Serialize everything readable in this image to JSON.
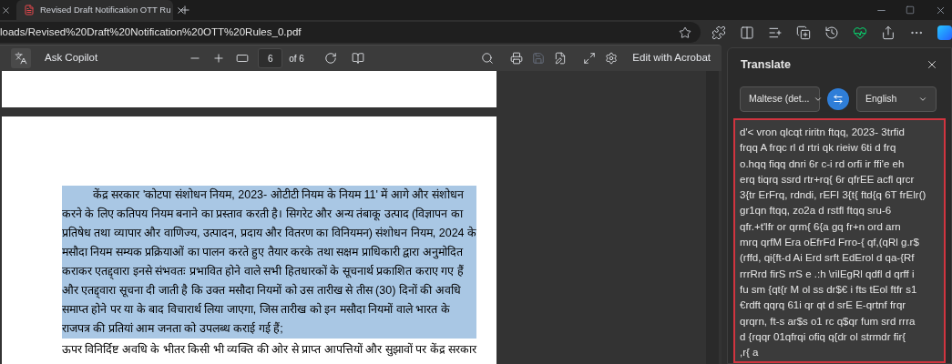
{
  "tabs": [
    {
      "title": "Revised Draft Notification OTT Ru",
      "selected": true
    }
  ],
  "address_bar": {
    "url": "loads/Revised%20Draft%20Notification%20OTT%20Rules_0.pdf"
  },
  "pdf_toolbar": {
    "ask_copilot": "Ask Copilot",
    "page_number": "6",
    "page_count": "of 6",
    "edit_button": "Edit with Acrobat",
    "save_disabled": true
  },
  "document": {
    "highlighted": true,
    "paragraph_lines": [
      "केंद्र सरकार 'कोटपा संशोधन नियम, 2023- ओटीटी नियम के नियम 11' में आगे और संशोधन",
      "करने के लिए कतिपय नियम बनाने का प्रस्ताव करती है। सिगरेट और अन्य तंबाकू उत्पाद (विज्ञापन का",
      "प्रतिषेध तथा व्यापार और वाणिज्य, उत्पादन, प्रदाय और वितरण का विनियमन) संशोधन नियम, 2024 के",
      "मसौदा नियम सम्यक प्रक्रियाओं का पालन करते हुए तैयार करके तथा सक्षम प्राधिकारी द्वारा अनुमोदित",
      "कराकर एतद्द्वारा इनसे संभवतः प्रभावित होने वाले सभी हितधारकों के सूचनार्थ प्रकाशित कराए गए हैं",
      "और एतद्द्वारा सूचना दी जाती है कि उक्त मसौदा नियमों को उस तारीख से तीस (30) दिनों की अवधि",
      "समाप्त होने पर या के बाद विचारार्थ लिया जाएगा, जिस तारीख को इन मसौदा नियमों वाले भारत के",
      "राजपत्र की प्रतियां आम जनता को उपलब्ध कराई गई हैं;"
    ],
    "next_line": "ऊपर विनिर्दिष्ट अवधि के भीतर किसी भी व्यक्ति की ओर से प्राप्त आपत्तियों और सुझावों पर केंद्र सरकार"
  },
  "translate_panel": {
    "title": "Translate",
    "source_language": "Maltese (det...",
    "target_language": "English",
    "output_lines": [
      "d'< vron qlcqt riritn ftqq, 2023- 3trfid",
      "frqq A frqc rl d rtri qk rieiw 6ti d frq",
      "o.hqq fiqq dnri 6r c-i rd orfi ir ffi'e eh",
      "erq tiqrq ssrd rtr+rq{ 6r qfrEE acfl qrcr",
      "3{tr ErFrq, rdndi, rEFI 3{t{ ftd{q 6T frElr()",
      "gr1qn ftqq, zo2a d rstfl ftqq sru-6",
      "qfr.+t'lfr or qrm{ 6{a gq fr+n ord arn",
      "mrq qrfM Era oEfrFd Frro-{ qf,(qRl g.r$",
      "(rffd, qi{ft-d Ai Erd srft EdErol d qa-{Rf",
      "rrrRrd firS rrS e .:h \\rilEgRl qdfl d qrff i",
      "fu sm {qt{r M ol ss dr$€ i fts tEol ftfr s1",
      "€rdft qqrq 61i qr qt d srE E-qrtnf frqr",
      "qrqrn, ft-s ar$s o1 rc q$qr fum srd rrra",
      "d {rqqr 01qfrqi ofiq q{dr ol strmdr fir{",
      ",r{ a"
    ]
  }
}
